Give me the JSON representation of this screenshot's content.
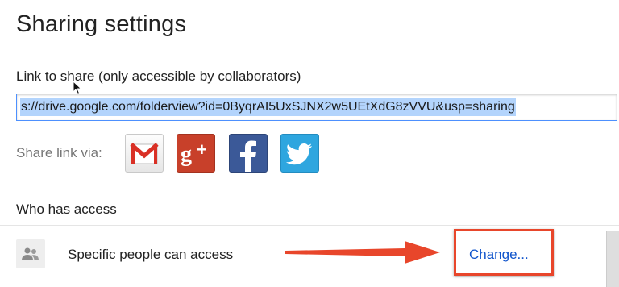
{
  "dialog": {
    "title": "Sharing settings"
  },
  "link_section": {
    "label": "Link to share (only accessible by collaborators)",
    "url_value": "s://drive.google.com/folderview?id=0ByqrAI5UxSJNX2w5UEtXdG8zVVU&usp=sharing"
  },
  "share_via": {
    "label": "Share link via:",
    "services": [
      {
        "name": "Gmail",
        "icon": "gmail-icon",
        "color": "#d93025"
      },
      {
        "name": "Google+",
        "icon": "google-plus-icon",
        "color": "#c8402a"
      },
      {
        "name": "Facebook",
        "icon": "facebook-icon",
        "color": "#3b5998"
      },
      {
        "name": "Twitter",
        "icon": "twitter-icon",
        "color": "#2ea6df"
      }
    ]
  },
  "access_section": {
    "label": "Who has access",
    "entry_text": "Specific people can access",
    "change_label": "Change..."
  },
  "annotation": {
    "arrow_color": "#e8462b",
    "highlight_color": "#e8462b"
  }
}
